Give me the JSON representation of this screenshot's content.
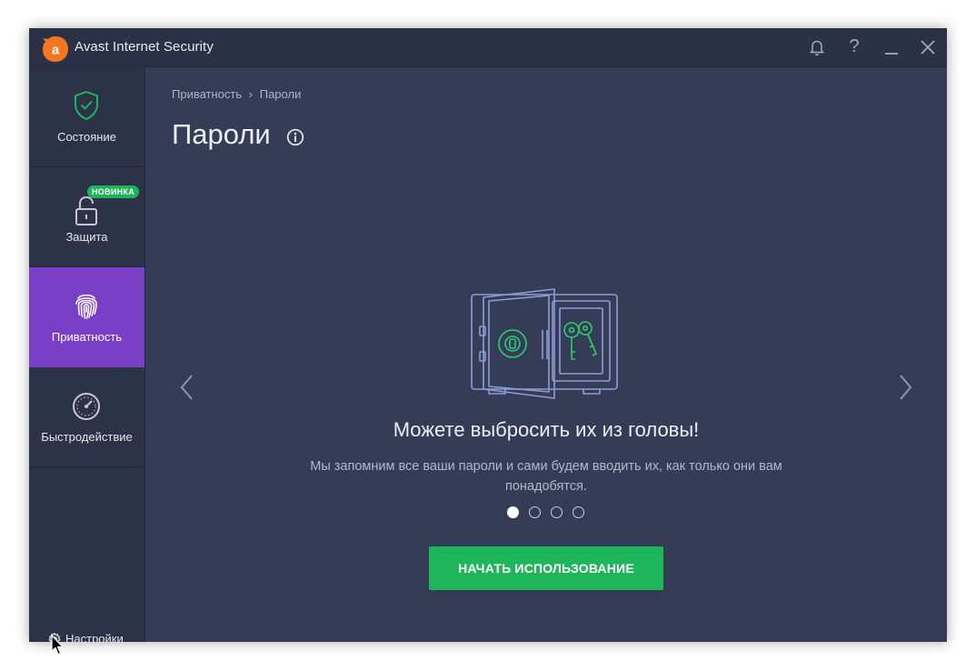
{
  "window": {
    "title": "Avast Internet Security",
    "accent_color": "#1fb55a",
    "brand_color": "#f47621",
    "active_nav_color": "#7a3fc7"
  },
  "titlebar": {
    "icons": [
      "bell-icon",
      "help-icon",
      "minimize-icon",
      "close-icon"
    ],
    "help_glyph": "?"
  },
  "sidebar": {
    "items": [
      {
        "label": "Состояние",
        "icon": "shield-check-icon",
        "active": false
      },
      {
        "label": "Защита",
        "icon": "padlock-icon",
        "badge": "НОВИНКА",
        "active": false
      },
      {
        "label": "Приватность",
        "icon": "fingerprint-icon",
        "active": true
      },
      {
        "label": "Быстродействие",
        "icon": "gauge-icon",
        "active": false
      }
    ],
    "settings_label": "Настройки"
  },
  "main": {
    "breadcrumb": [
      "Приватность",
      "›",
      "Пароли"
    ],
    "title": "Пароли",
    "headline": "Можете выбросить их из головы!",
    "description": "Мы запомним все ваши пароли и сами будем вводить их, как только они вам понадобятся.",
    "carousel": {
      "slides": 4,
      "active_slide": 1
    },
    "cta_label": "НАЧАТЬ ИСПОЛЬЗОВАНИЕ"
  }
}
